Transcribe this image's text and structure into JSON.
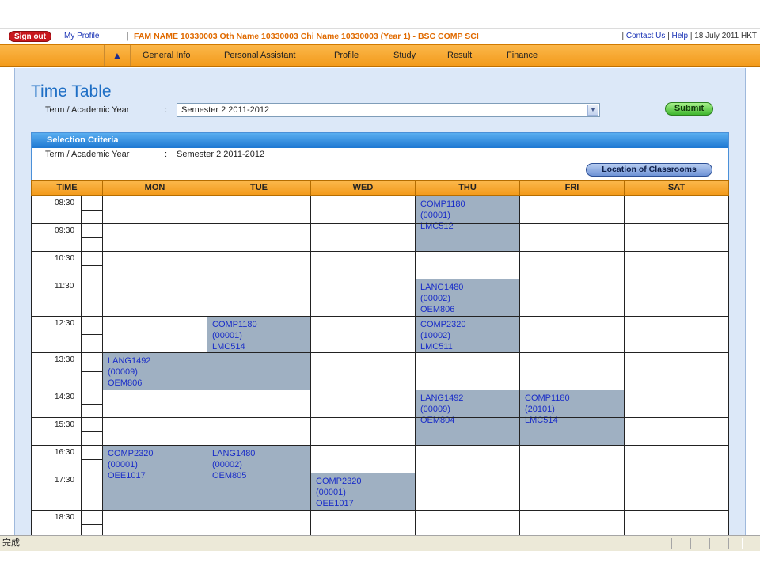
{
  "topbar": {
    "signout_label": "Sign out",
    "my_profile_label": "My Profile",
    "student_line": "FAM NAME 10330003 Oth Name 10330003 Chi Name 10330003 (Year 1) - BSC COMP SCI",
    "contact_label": "Contact Us",
    "help_label": "Help",
    "date_text": "18 July 2011 HKT"
  },
  "nav": {
    "items": [
      "General Info",
      "Personal Assistant",
      "Profile",
      "Study",
      "Result",
      "Finance"
    ]
  },
  "page": {
    "title": "Time Table",
    "term_label": "Term / Academic Year",
    "colon": ":",
    "term_selected": "Semester 2 2011-2012",
    "submit_label": "Submit"
  },
  "selection": {
    "header": "Selection Criteria",
    "term_label": "Term / Academic Year",
    "colon": ":",
    "term_value": "Semester 2 2011-2012",
    "location_button": "Location of Classrooms"
  },
  "timetable": {
    "headers": [
      "TIME",
      "MON",
      "TUE",
      "WED",
      "THU",
      "FRI",
      "SAT"
    ],
    "times": [
      "08:30",
      "09:30",
      "10:30",
      "11:30",
      "12:30",
      "13:30",
      "14:30",
      "15:30",
      "16:30",
      "17:30",
      "18:30"
    ],
    "events": [
      {
        "day": 4,
        "start": 0,
        "span": 2,
        "lines": [
          "COMP1180",
          "(00001)",
          "LMC512"
        ]
      },
      {
        "day": 4,
        "start": 3,
        "span": 1,
        "lines": [
          "LANG1480",
          "(00002)",
          "OEM806"
        ]
      },
      {
        "day": 2,
        "start": 4,
        "span": 2,
        "lines": [
          "COMP1180",
          "(00001)",
          "LMC514"
        ]
      },
      {
        "day": 4,
        "start": 4,
        "span": 1,
        "lines": [
          "COMP2320",
          "(10002)",
          "LMC511"
        ]
      },
      {
        "day": 1,
        "start": 5,
        "span": 1,
        "lines": [
          "LANG1492",
          "(00009)",
          "OEM806"
        ]
      },
      {
        "day": 4,
        "start": 6,
        "span": 2,
        "lines": [
          "LANG1492",
          "(00009)",
          "OEM804"
        ]
      },
      {
        "day": 5,
        "start": 6,
        "span": 2,
        "lines": [
          "COMP1180",
          "(20101)",
          "LMC514"
        ]
      },
      {
        "day": 1,
        "start": 8,
        "span": 2,
        "lines": [
          "COMP2320",
          "(00001)",
          "OEE1017"
        ]
      },
      {
        "day": 2,
        "start": 8,
        "span": 2,
        "lines": [
          "LANG1480",
          "(00002)",
          "OEM805"
        ]
      },
      {
        "day": 3,
        "start": 9,
        "span": 1,
        "lines": [
          "COMP2320",
          "(00001)",
          "OEE1017"
        ]
      }
    ]
  },
  "statusbar": {
    "text": "完成"
  }
}
